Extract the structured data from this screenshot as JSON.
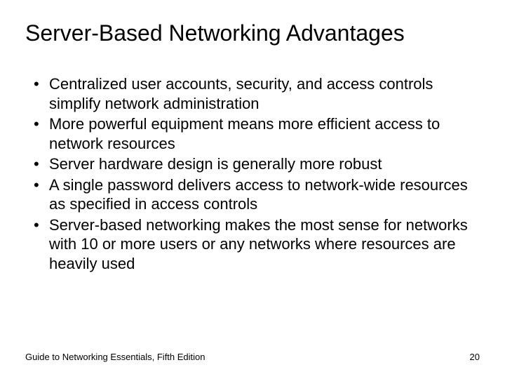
{
  "title": "Server-Based Networking Advantages",
  "bullets": [
    "Centralized user accounts, security, and access controls simplify network administration",
    "More powerful equipment means more efficient access to network resources",
    "Server hardware design is generally more robust",
    "A single password delivers access to network-wide resources as specified in access controls",
    "Server-based networking makes the most sense for networks with 10 or more users or any networks where resources are heavily used"
  ],
  "footer": {
    "source": "Guide to Networking Essentials, Fifth Edition",
    "page": "20"
  }
}
